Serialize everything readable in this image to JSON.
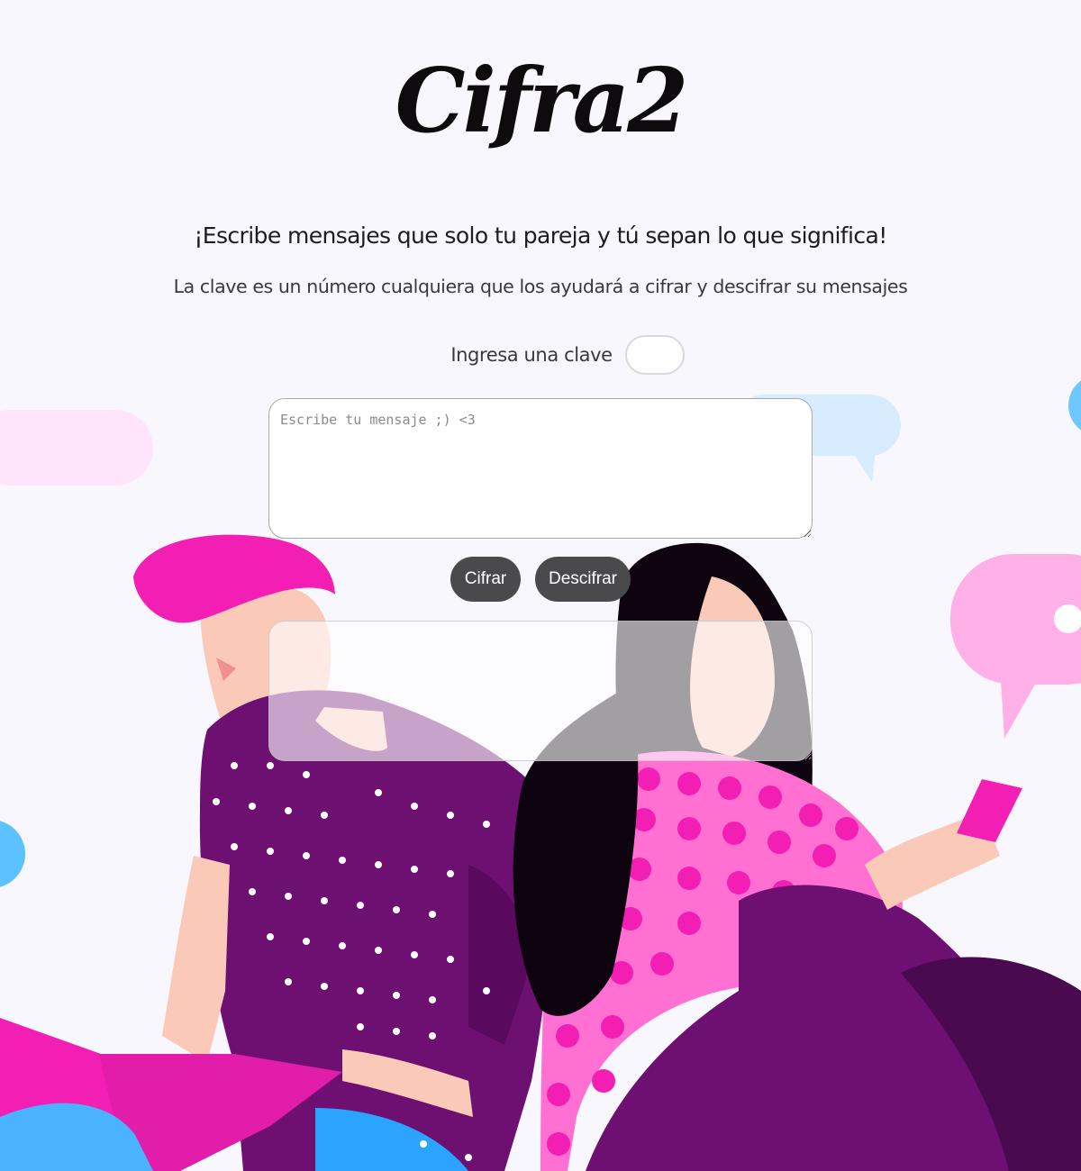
{
  "header": {
    "logo_text": "Cifra2"
  },
  "intro": {
    "headline": "¡Escribe mensajes que solo tu pareja y tú sepan lo que significa!",
    "description": "La clave es un número cualquiera que los ayudará a cifrar y descifrar su mensajes"
  },
  "key": {
    "label": "Ingresa una clave",
    "value": ""
  },
  "message": {
    "placeholder": "Escribe tu mensaje ;) <3",
    "value": ""
  },
  "actions": {
    "encrypt_label": "Cifrar",
    "decrypt_label": "Descifrar"
  },
  "result": {
    "value": ""
  },
  "colors": {
    "background": "#f8f7fd",
    "button": "#4a4a4c",
    "magenta": "#f31fb4",
    "purple": "#6e0f72",
    "pink_light": "#ffb0e6",
    "blue": "#5cc2ff"
  }
}
